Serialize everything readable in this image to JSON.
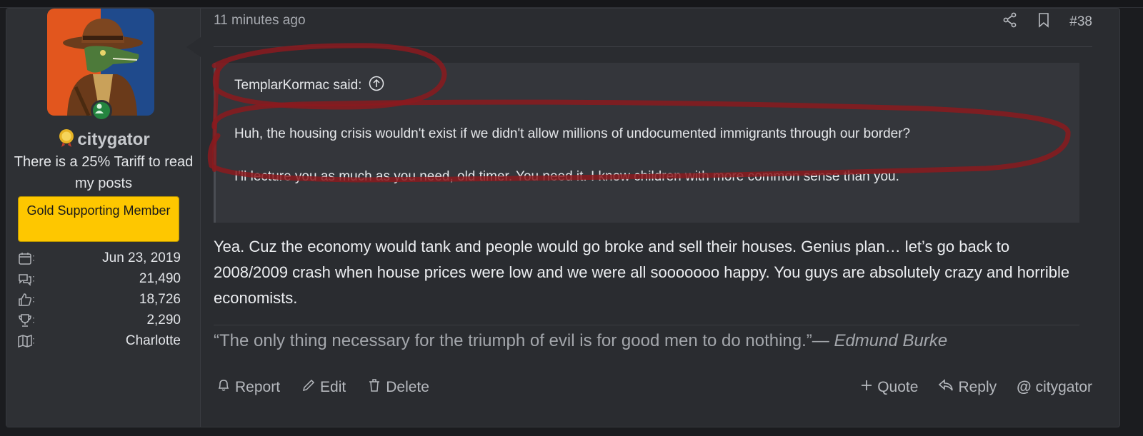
{
  "user": {
    "username": "citygator",
    "title": "There is a 25% Tariff to read my posts",
    "banner": "Gold Supporting Member",
    "stats": [
      {
        "icon": "calendar-icon",
        "sep": ":",
        "value": "Jun 23, 2019"
      },
      {
        "icon": "messages-icon",
        "sep": ":",
        "value": "21,490"
      },
      {
        "icon": "thumbs-up-icon",
        "sep": ":",
        "value": "18,726"
      },
      {
        "icon": "trophy-icon",
        "sep": ":",
        "value": "2,290"
      },
      {
        "icon": "map-icon",
        "sep": ":",
        "value": "Charlotte"
      }
    ]
  },
  "post": {
    "timestamp": "11 minutes ago",
    "number": "#38",
    "quote": {
      "author": "TemplarKormac said:",
      "lines": [
        "Huh, the housing crisis wouldn't exist if we didn't allow millions of undocumented immigrants through our border?",
        "I'll lecture you as much as you need, old timer. You need it. I know children with more common sense than you."
      ]
    },
    "message": "Yea. Cuz the economy would tank and people would go broke and sell their houses. Genius plan… let’s go back to 2008/2009 crash when house prices were low and we were all sooooooo happy. You guys are absolutely crazy and horrible economists.",
    "signature": {
      "quote": "“The only thing necessary for the triumph of evil is for good men to do nothing.”",
      "attribution": "— Edmund Burke"
    }
  },
  "actions": {
    "report": "Report",
    "edit": "Edit",
    "delete": "Delete",
    "quote": "Quote",
    "reply": "Reply",
    "mention": "citygator"
  },
  "colors": {
    "banner": "#fec700",
    "scribble": "#8b1a1e",
    "online": "#24843f"
  }
}
